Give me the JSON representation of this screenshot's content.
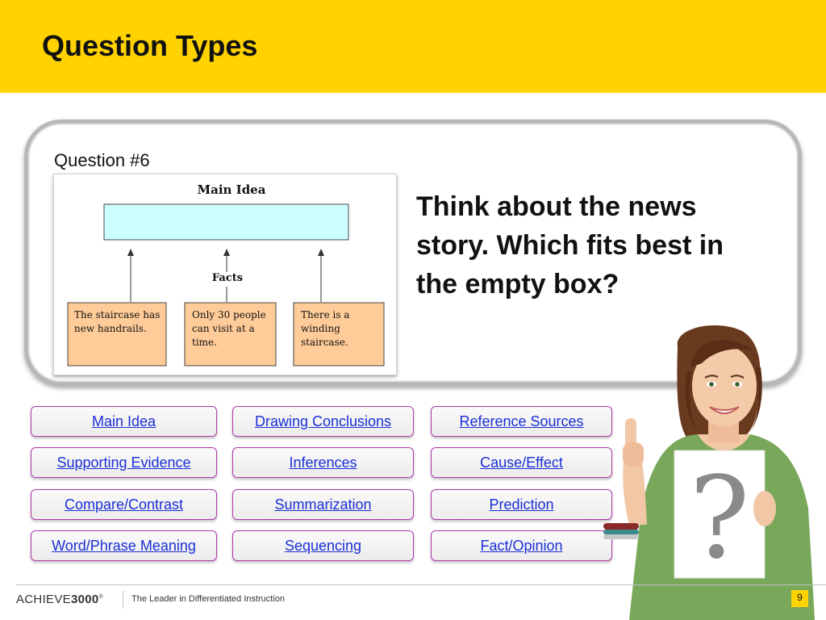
{
  "slide": {
    "title": "Question Types",
    "question_number": "Question #6",
    "prompt": "Think about the news story. Which fits best in the empty box?",
    "page_number": "9"
  },
  "diagram": {
    "heading": "Main Idea",
    "facts_label": "Facts",
    "fact_boxes": [
      [
        "The staircase has",
        "new handrails."
      ],
      [
        "Only 30 people",
        "can visit at a",
        "time."
      ],
      [
        "There is a",
        "winding",
        "staircase."
      ]
    ]
  },
  "buttons": [
    [
      "Main Idea",
      "Drawing Conclusions",
      "Reference Sources"
    ],
    [
      "Supporting Evidence",
      "Inferences",
      "Cause/Effect"
    ],
    [
      "Compare/Contrast",
      "Summarization",
      "Prediction"
    ],
    [
      "Word/Phrase Meaning",
      "Sequencing",
      "Fact/Opinion"
    ]
  ],
  "footer": {
    "logo_light": "ACHIEVE",
    "logo_bold": "3000",
    "logo_mark": "®",
    "tagline": "The Leader in Differentiated Instruction"
  },
  "illustration": {
    "sign_text": "?"
  },
  "colors": {
    "header": "#ffd200",
    "button_border": "#b03aa8",
    "link": "#1a2fd6",
    "fact_box": "#ffcc99",
    "main_idea_box": "#ccffff"
  }
}
